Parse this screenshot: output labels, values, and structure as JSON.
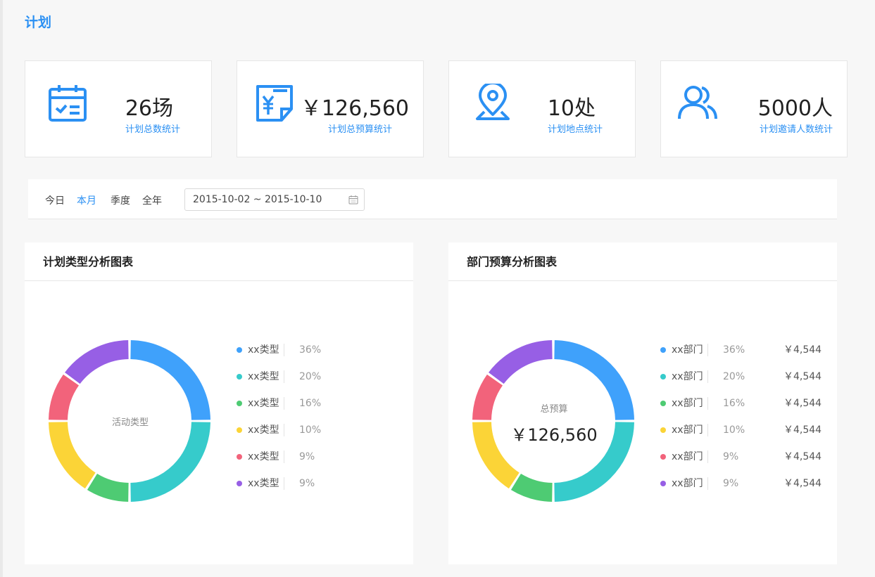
{
  "page": {
    "title": "计划"
  },
  "colors": {
    "accent": "#2b90f3",
    "series": [
      "#3fa1fb",
      "#36cbcb",
      "#4ecb73",
      "#fbd437",
      "#f2637b",
      "#975fe5"
    ]
  },
  "stats": [
    {
      "icon": "calendar-check-icon",
      "value": "26场",
      "label": "计划总数统计"
    },
    {
      "icon": "yen-document-icon",
      "value": "￥126,560",
      "label": "计划总预算统计"
    },
    {
      "icon": "location-pin-icon",
      "value": "10处",
      "label": "计划地点统计"
    },
    {
      "icon": "users-icon",
      "value": "5000人",
      "label": "计划邀请人数统计"
    }
  ],
  "filter": {
    "tabs": [
      "今日",
      "本月",
      "季度",
      "全年"
    ],
    "active_tab": "本月",
    "date_range": "2015-10-02 ~ 2015-10-10"
  },
  "panels": [
    {
      "title": "计划类型分析图表",
      "center_label": "活动类型",
      "center_value": "",
      "legend": [
        {
          "name": "xx类型",
          "percent": "36%"
        },
        {
          "name": "xx类型",
          "percent": "20%"
        },
        {
          "name": "xx类型",
          "percent": "16%"
        },
        {
          "name": "xx类型",
          "percent": "10%"
        },
        {
          "name": "xx类型",
          "percent": "9%"
        },
        {
          "name": "xx类型",
          "percent": "9%"
        }
      ]
    },
    {
      "title": "部门预算分析图表",
      "center_label": "总预算",
      "center_value": "￥126,560",
      "legend": [
        {
          "name": "xx部门",
          "percent": "36%",
          "amount": "￥4,544"
        },
        {
          "name": "xx部门",
          "percent": "20%",
          "amount": "￥4,544"
        },
        {
          "name": "xx部门",
          "percent": "16%",
          "amount": "￥4,544"
        },
        {
          "name": "xx部门",
          "percent": "10%",
          "amount": "￥4,544"
        },
        {
          "name": "xx部门",
          "percent": "9%",
          "amount": "￥4,544"
        },
        {
          "name": "xx部门",
          "percent": "9%",
          "amount": "￥4,544"
        }
      ]
    }
  ],
  "chart_data": [
    {
      "type": "pie",
      "title": "计划类型分析图表",
      "categories": [
        "xx类型",
        "xx类型",
        "xx类型",
        "xx类型",
        "xx类型",
        "xx类型"
      ],
      "values": [
        25,
        25,
        9,
        16,
        10,
        15
      ]
    },
    {
      "type": "pie",
      "title": "部门预算分析图表",
      "categories": [
        "xx部门",
        "xx部门",
        "xx部门",
        "xx部门",
        "xx部门",
        "xx部门"
      ],
      "values": [
        25,
        25,
        9,
        16,
        10,
        15
      ]
    }
  ]
}
